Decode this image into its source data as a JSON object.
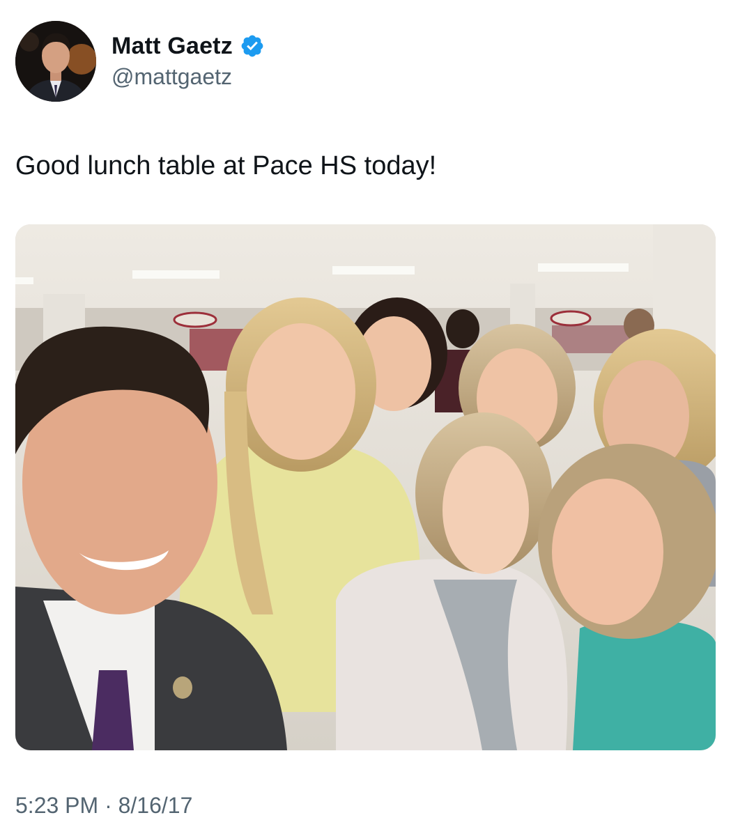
{
  "author": {
    "display_name": "Matt Gaetz",
    "handle": "@mattgaetz",
    "verified": true,
    "verified_icon": "verified-badge-icon",
    "avatar_icon": "profile-photo"
  },
  "tweet": {
    "text": "Good lunch table at Pace HS today!",
    "media_description_icon": "selfie-photo",
    "time": "5:23 PM",
    "separator": "·",
    "date": "8/16/17"
  },
  "colors": {
    "text_primary": "#0f1419",
    "text_secondary": "#536471",
    "verified_blue": "#1d9bf0",
    "background": "#ffffff"
  }
}
